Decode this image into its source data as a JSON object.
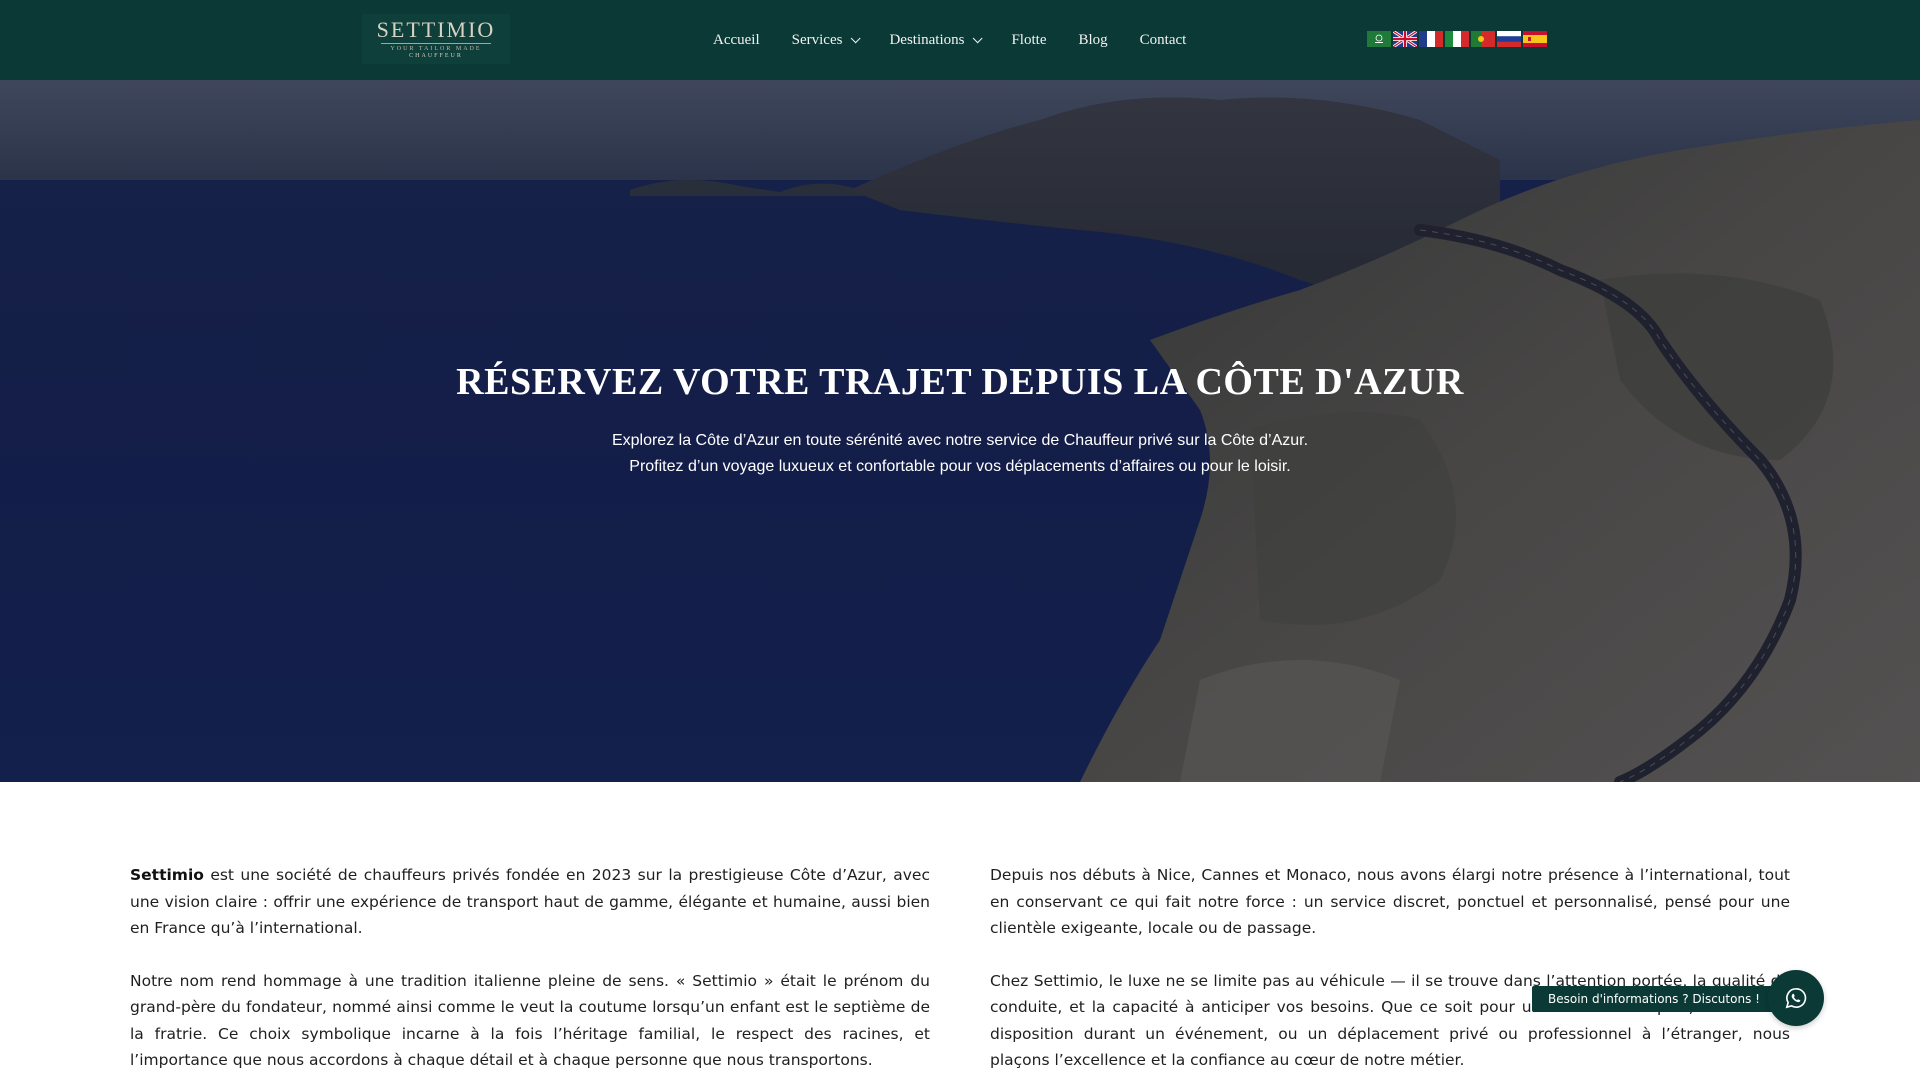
{
  "header": {
    "logo": {
      "main": "SETTIMIO",
      "tagline": "YOUR TAILOR MADE",
      "sub": "CHAUFFEUR"
    },
    "nav": [
      {
        "label": "Accueil"
      },
      {
        "label": "Services"
      },
      {
        "label": "Destinations"
      },
      {
        "label": "Flotte"
      },
      {
        "label": "Blog"
      },
      {
        "label": "Contact"
      }
    ],
    "languages": [
      "arabic-flag-icon",
      "uk-flag-icon",
      "france-flag-icon",
      "italy-flag-icon",
      "portugal-flag-icon",
      "russia-flag-icon",
      "spain-flag-icon"
    ]
  },
  "hero": {
    "title": "RÉSERVEZ VOTRE TRAJET DEPUIS LA CÔTE D'AZUR",
    "subtitle_line1": "Explorez la Côte d’Azur en toute sérénité avec notre service de Chauffeur privé sur la Côte d’Azur.",
    "subtitle_line2": "Profitez d’un voyage luxueux et confortable pour vos déplacements d’affaires ou pour le loisir."
  },
  "content": {
    "left": {
      "p1_bold": "Settimio",
      "p1_rest": " est une société de chauffeurs privés fondée en 2023 sur la prestigieuse Côte d’Azur, avec une vision claire : offrir une expérience de transport haut de gamme, élégante et humaine, aussi bien en France qu’à l’international.",
      "p2": "Notre nom rend hommage à une tradition italienne pleine de sens. « Settimio » était le prénom du grand-père du fondateur, nommé ainsi comme le veut la coutume lorsqu’un enfant est le septième de la fratrie. Ce choix symbolique incarne à la fois l’héritage familial, le respect des racines, et l’importance que nous accordons à chaque détail et à chaque personne que nous transportons."
    },
    "right": {
      "p1": "Depuis nos débuts à Nice, Cannes et Monaco, nous avons élargi notre présence à l’international, tout en conservant ce qui fait notre force : un service discret, ponctuel et personnalisé, pensé pour une clientèle exigeante, locale ou de passage.",
      "p2": "Chez Settimio, le luxe ne se limite pas au véhicule — il se trouve dans l’attention portée, la qualité de conduite, et la capacité à anticiper vos besoins. Que ce soit pour un transfert aéroport, une mise à disposition durant un événement, ou un déplacement privé ou professionnel à l’étranger, nous plaçons l’excellence et la confiance au cœur de notre métier."
    }
  },
  "chat": {
    "label": "Besoin d'informations ? Discutons !",
    "icon": "whatsapp-icon"
  },
  "colors": {
    "brand": "#0b3a36",
    "text": "#1f1f1f"
  }
}
